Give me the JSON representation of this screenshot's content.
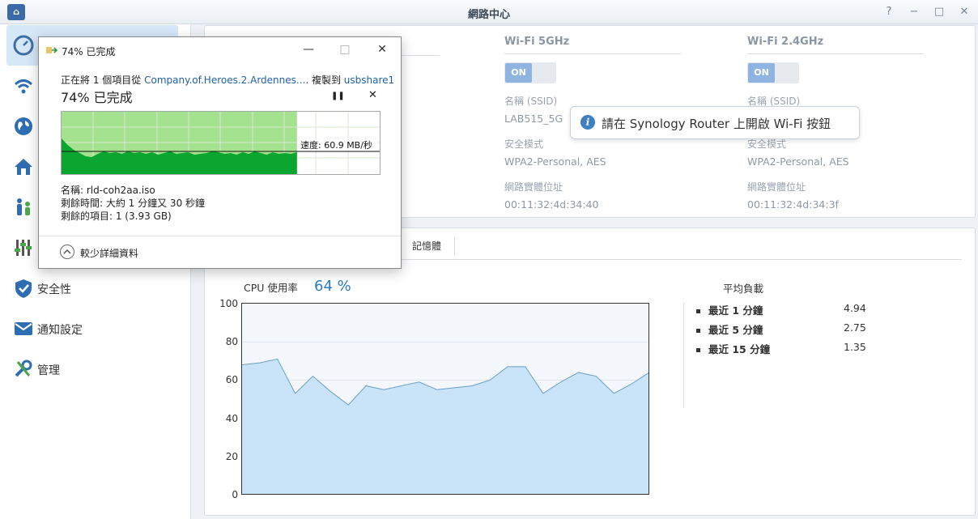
{
  "window": {
    "title": "網路中心",
    "controls": [
      "?",
      "−",
      "□",
      "✕"
    ]
  },
  "sidebar": {
    "items": [
      {
        "label": "",
        "icon": "gauge-icon",
        "active": true
      },
      {
        "label": "",
        "icon": "wifi-icon"
      },
      {
        "label": "",
        "icon": "globe-icon"
      },
      {
        "label": "",
        "icon": "home-icon"
      },
      {
        "label": "",
        "icon": "family-icon"
      },
      {
        "label": "",
        "icon": "sliders-icon"
      },
      {
        "label": "安全性",
        "icon": "shield-icon"
      },
      {
        "label": "通知設定",
        "icon": "envelope-icon"
      },
      {
        "label": "管理",
        "icon": "tools-icon"
      }
    ]
  },
  "wifi": {
    "columns": [
      {
        "header": "Wi-Fi 5GHz",
        "toggle": "ON",
        "ssid_label": "名稱 (SSID)",
        "ssid": "LAB515_5G",
        "security_label": "安全模式",
        "security": "WPA2-Personal, AES",
        "mac_label": "網路實體位址",
        "mac": "00:11:32:4d:34:40"
      },
      {
        "header": "Wi-Fi 2.4GHz",
        "toggle": "ON",
        "ssid_label": "名稱 (SSID)",
        "ssid": "",
        "security_label": "安全模式",
        "security": "WPA2-Personal, AES",
        "mac_label": "網路實體位址",
        "mac": "00:11:32:4d:34:3f"
      }
    ],
    "tooltip": "請在 Synology Router 上開啟 Wi-Fi 按鈕"
  },
  "resources": {
    "tab_memory": "記憶體",
    "cpu_label": "CPU 使用率",
    "cpu_value": "64 %",
    "load_title": "平均負載",
    "loads": [
      {
        "label": "最近 1 分鐘",
        "value": "4.94"
      },
      {
        "label": "最近 5 分鐘",
        "value": "2.75"
      },
      {
        "label": "最近 15 分鐘",
        "value": "1.35"
      }
    ]
  },
  "chart_data": {
    "type": "area",
    "title": "",
    "ylim": [
      0,
      100
    ],
    "yticks": [
      "100",
      "80",
      "60",
      "40",
      "20",
      "0"
    ],
    "values": [
      68,
      69,
      71,
      53,
      62,
      54,
      47,
      57,
      55,
      57,
      59,
      55,
      56,
      57,
      60,
      67,
      67,
      53,
      59,
      64,
      62,
      53,
      58,
      64
    ],
    "grid": true,
    "colors": {
      "fill": "#c9e3f8",
      "line": "#6c9fc9"
    }
  },
  "dialog": {
    "title": "74% 已完成",
    "line1_prefix": "正在將 1 個項目從 ",
    "source": "Company.of.Heroes.2.Ardennes....",
    "line1_mid": " 複製到 ",
    "destination": "usbshare1",
    "progress_text": "74% 已完成",
    "progress": 0.74,
    "speed": "速度: 60.9 MB/秒",
    "name": "名稱: rld-coh2aa.iso",
    "time_left": "剩餘時間: 大約 1 分鐘又 30 秒鐘",
    "items_left": "剩餘的項目: 1 (3.93 GB)",
    "fewer_details": "較少詳細資料",
    "controls": [
      "—",
      "□",
      "✕"
    ],
    "pause": "❚❚",
    "cancel": "✕",
    "speed_trace": [
      44,
      36,
      30,
      26,
      22,
      21,
      25,
      28,
      26,
      27,
      25,
      28,
      26,
      27,
      25,
      27,
      24,
      26,
      28,
      25,
      26,
      27,
      24,
      25,
      26,
      28,
      27,
      25,
      26,
      24,
      27,
      25,
      28,
      26,
      24,
      27,
      25,
      26,
      25,
      27
    ]
  }
}
